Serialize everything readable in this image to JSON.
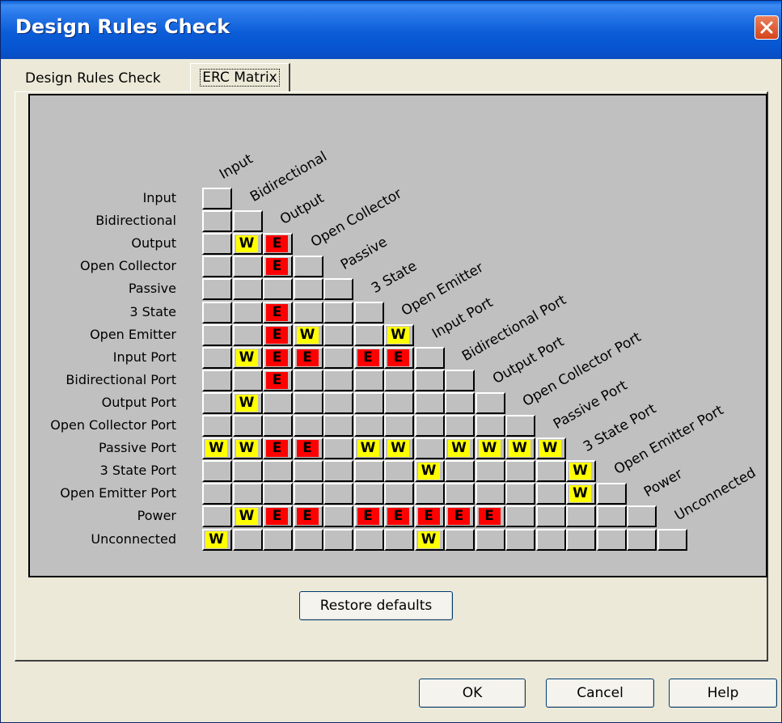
{
  "window": {
    "title": "Design Rules Check"
  },
  "tabs": [
    {
      "label": "Design Rules Check",
      "active": false
    },
    {
      "label": "ERC Matrix",
      "active": true
    }
  ],
  "matrix": {
    "pins": [
      "Input",
      "Bidirectional",
      "Output",
      "Open Collector",
      "Passive",
      "3 State",
      "Open Emitter",
      "Input Port",
      "Bidirectional Port",
      "Output Port",
      "Open Collector Port",
      "Passive Port",
      "3 State Port",
      "Open Emitter Port",
      "Power",
      "Unconnected"
    ],
    "rows": [
      [
        ""
      ],
      [
        "",
        ""
      ],
      [
        "",
        "W",
        "E"
      ],
      [
        "",
        "",
        "E",
        ""
      ],
      [
        "",
        "",
        "",
        "",
        ""
      ],
      [
        "",
        "",
        "E",
        "",
        "",
        ""
      ],
      [
        "",
        "",
        "E",
        "W",
        "",
        "",
        "W"
      ],
      [
        "",
        "W",
        "E",
        "E",
        "",
        "E",
        "E",
        ""
      ],
      [
        "",
        "",
        "E",
        "",
        "",
        "",
        "",
        "",
        ""
      ],
      [
        "",
        "W",
        "",
        "",
        "",
        "",
        "",
        "",
        "",
        ""
      ],
      [
        "",
        "",
        "",
        "",
        "",
        "",
        "",
        "",
        "",
        "",
        ""
      ],
      [
        "W",
        "W",
        "E",
        "E",
        "",
        "W",
        "W",
        "",
        "W",
        "W",
        "W",
        "W"
      ],
      [
        "",
        "",
        "",
        "",
        "",
        "",
        "",
        "W",
        "",
        "",
        "",
        "",
        "W"
      ],
      [
        "",
        "",
        "",
        "",
        "",
        "",
        "",
        "",
        "",
        "",
        "",
        "",
        "W",
        ""
      ],
      [
        "",
        "W",
        "E",
        "E",
        "",
        "E",
        "E",
        "E",
        "E",
        "E",
        "",
        "",
        "",
        "",
        ""
      ],
      [
        "W",
        "",
        "",
        "",
        "",
        "",
        "",
        "W",
        "",
        "",
        "",
        "",
        "",
        "",
        "",
        ""
      ]
    ]
  },
  "buttons": {
    "restore": "Restore defaults",
    "ok": "OK",
    "cancel": "Cancel",
    "help": "Help"
  },
  "colors": {
    "warning": "#ffff00",
    "error": "#ff0000",
    "matrix_bg": "#c0c0c0"
  }
}
